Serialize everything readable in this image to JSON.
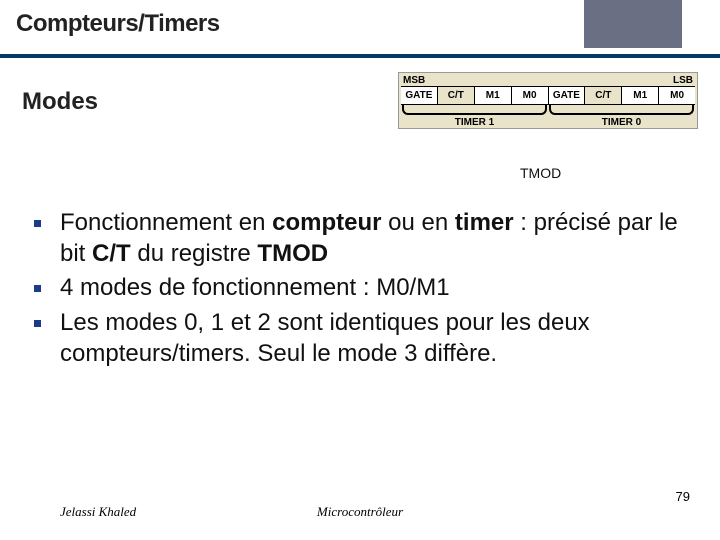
{
  "slide": {
    "title": "Compteurs/Timers",
    "subtitle": "Modes"
  },
  "tmod": {
    "msb": "MSB",
    "lsb": "LSB",
    "bits": [
      "GATE",
      "C/T",
      "M1",
      "M0",
      "GATE",
      "C/T",
      "M1",
      "M0"
    ],
    "timer1": "TIMER 1",
    "timer0": "TIMER 0",
    "caption": "TMOD"
  },
  "bullets": {
    "b1_pre": "Fonctionnement en ",
    "b1_bold1": "compteur",
    "b1_mid": " ou en ",
    "b1_bold2": "timer",
    "b1_colon": " : précisé par le bit ",
    "b1_bold3": "C/T",
    "b1_mid2": " du registre ",
    "b1_bold4": "TMOD",
    "b2": "4 modes de fonctionnement : M0/M1",
    "b3": "Les modes 0, 1 et 2 sont identiques pour les deux compteurs/timers. Seul le mode 3 diffère."
  },
  "footer": {
    "author": "Jelassi Khaled",
    "center": "Microcontrôleur",
    "page": "79"
  }
}
